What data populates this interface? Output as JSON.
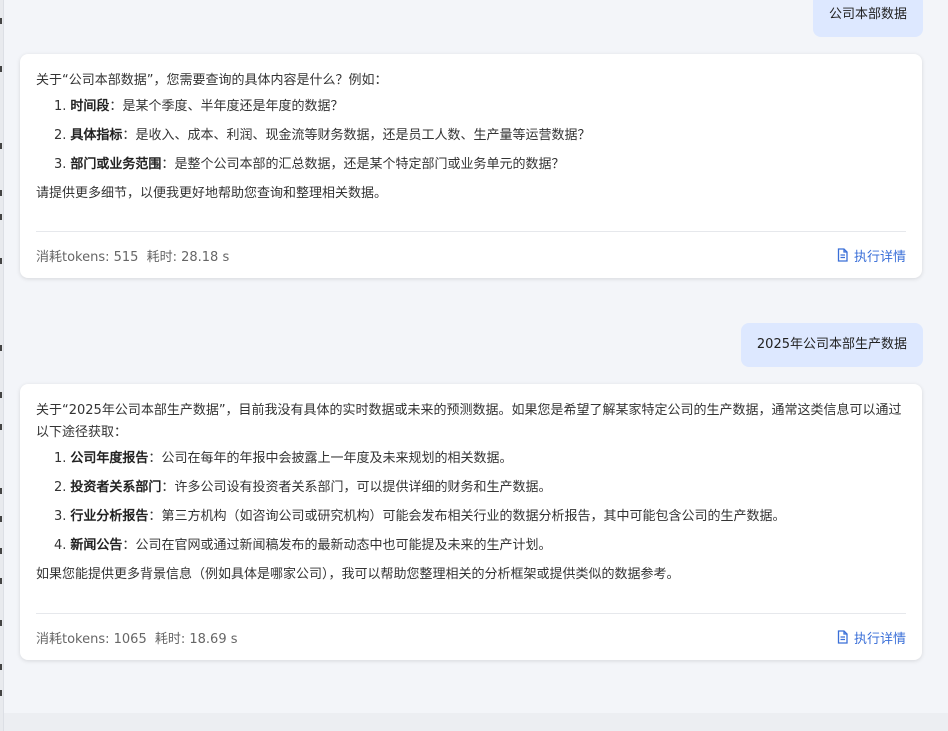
{
  "conversation": {
    "user_message_1": "公司本部数据",
    "assistant_reply_1": {
      "intro": "关于“公司本部数据”，您需要查询的具体内容是什么？例如：",
      "items": [
        {
          "num": "1.",
          "label": "时间段",
          "sep": "：",
          "text": "是某个季度、半年度还是年度的数据？"
        },
        {
          "num": "2.",
          "label": "具体指标",
          "sep": "：",
          "text": "是收入、成本、利润、现金流等财务数据，还是员工人数、生产量等运营数据？"
        },
        {
          "num": "3.",
          "label": "部门或业务范围",
          "sep": "：",
          "text": "是整个公司本部的汇总数据，还是某个特定部门或业务单元的数据？"
        }
      ],
      "outro": "请提供更多细节，以便我更好地帮助您查询和整理相关数据。",
      "tokens_label": "消耗tokens: 515",
      "time_label": "耗时: 28.18 s",
      "details_label": "执行详情"
    },
    "user_message_2": "2025年公司本部生产数据",
    "assistant_reply_2": {
      "intro": "关于“2025年公司本部生产数据”，目前我没有具体的实时数据或未来的预测数据。如果您是希望了解某家特定公司的生产数据，通常这类信息可以通过以下途径获取：",
      "items": [
        {
          "num": "1.",
          "label": "公司年度报告",
          "sep": "：",
          "text": "公司在每年的年报中会披露上一年度及未来规划的相关数据。"
        },
        {
          "num": "2.",
          "label": "投资者关系部门",
          "sep": "：",
          "text": "许多公司设有投资者关系部门，可以提供详细的财务和生产数据。"
        },
        {
          "num": "3.",
          "label": "行业分析报告",
          "sep": "：",
          "text": "第三方机构（如咨询公司或研究机构）可能会发布相关行业的数据分析报告，其中可能包含公司的生产数据。"
        },
        {
          "num": "4.",
          "label": "新闻公告",
          "sep": "：",
          "text": "公司在官网或通过新闻稿发布的最新动态中也可能提及未来的生产计划。"
        }
      ],
      "outro": "如果您能提供更多背景信息（例如具体是哪家公司），我可以帮助您整理相关的分析框架或提供类似的数据参考。",
      "tokens_label": "消耗tokens: 1065",
      "time_label": "耗时: 18.69 s",
      "details_label": "执行详情"
    }
  },
  "colors": {
    "user_bubble_bg": "#dde8ff",
    "link_blue": "#3a6fd8",
    "page_bg": "#f3f5f9"
  },
  "icons": {
    "details": "document-icon"
  }
}
